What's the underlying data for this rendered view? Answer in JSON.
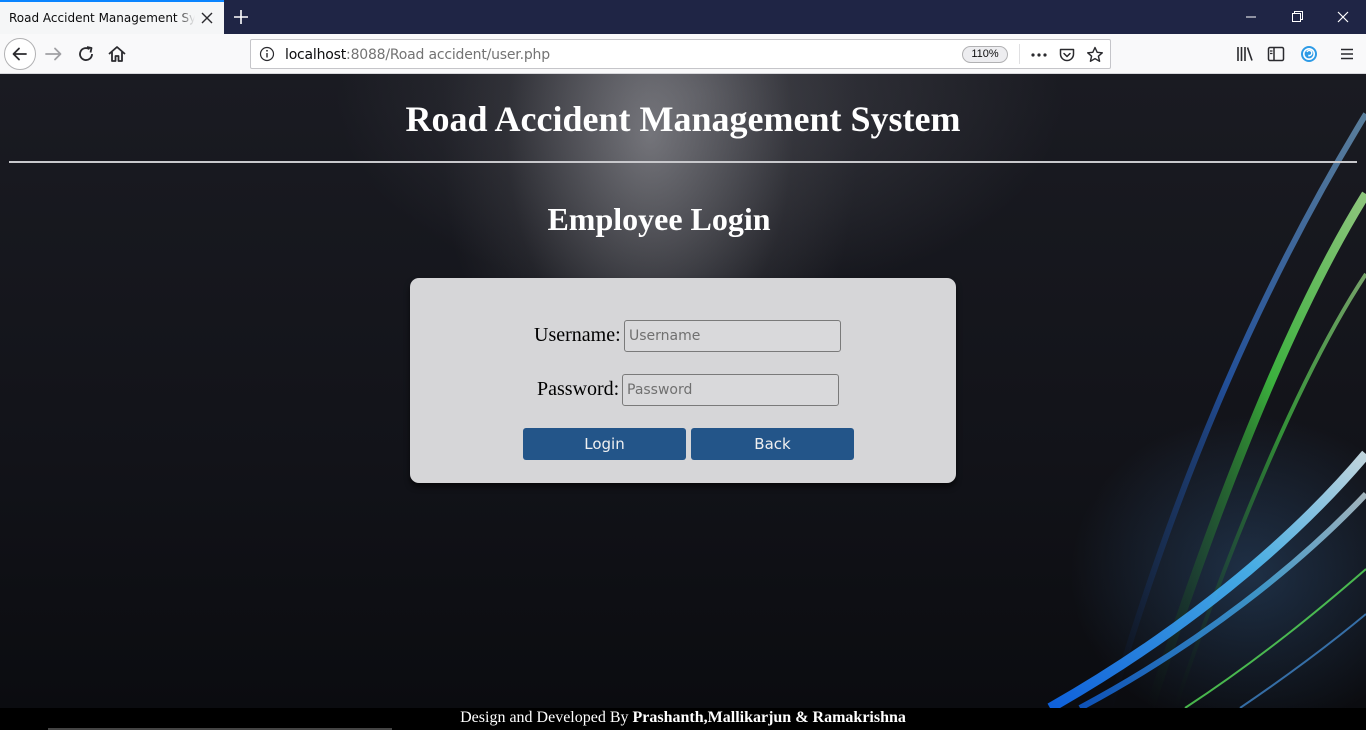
{
  "browser": {
    "tab_title": "Road Accident Management System",
    "url_host": "localhost",
    "url_rest": ":8088/Road accident/user.php",
    "zoom": "110%"
  },
  "page": {
    "title": "Road Accident Management System",
    "heading": "Employee Login"
  },
  "form": {
    "username_label": "Username:",
    "username_placeholder": "Username",
    "username_value": "",
    "password_label": "Password:",
    "password_placeholder": "Password",
    "password_value": "",
    "login_button": "Login",
    "back_button": "Back"
  },
  "footer": {
    "prefix": "Design and Developed By ",
    "names": "Prashanth,Mallikarjun & Ramakrishna"
  },
  "icons": [
    "back-arrow-icon",
    "forward-arrow-icon",
    "reload-icon",
    "home-icon",
    "info-icon",
    "more-icon",
    "pocket-icon",
    "bookmark-star-icon",
    "library-icon",
    "sidebar-icon",
    "extension-icon",
    "menu-icon",
    "close-icon",
    "plus-icon",
    "minimize-icon",
    "restore-icon"
  ],
  "colors": {
    "button_bg": "#235589",
    "card_bg": "#d6d6d8",
    "tab_accent": "#0a84ff",
    "tabbar_bg": "#1f2545"
  }
}
